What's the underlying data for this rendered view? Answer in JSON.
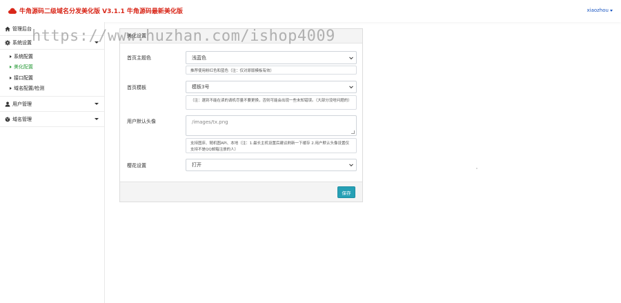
{
  "header": {
    "title": "牛角源码二级域名分发美化版 V3.1.1 牛角源码最新美化版",
    "brand_color": "#d9281a",
    "user": "xiaozhou"
  },
  "sidebar": {
    "top_item": "管理后台",
    "groups": [
      {
        "label": "系统设置",
        "items": [
          "系统配置",
          "美化配置",
          "接口配置",
          "域名配置/检测"
        ],
        "active_index": 1
      },
      {
        "label": "用户管理"
      },
      {
        "label": "域名管理"
      }
    ],
    "active_color": "#2e9d3e"
  },
  "main": {
    "card_title": "美化设置",
    "fields": [
      {
        "label": "首页主题色",
        "value": "浅蓝色",
        "help": "推荐使用粉红色和蓝色（注：仅对原版模板有效）"
      },
      {
        "label": "首页模板",
        "value": "模板3号",
        "help": "（注：選到不能在读的请机尽量不要更换，否则可能会出现一些未知错误。（大部分没啥问题的）"
      },
      {
        "label": "用户默认头像",
        "value": "/images/tx.png",
        "help": "支持图床、随机图API、本地（注：1.最长主机设置后建议刷新一下缓存 2.用户默认头像设置仅支持不是QQ邮箱注册的人）"
      },
      {
        "label": "樱花设置",
        "value": "打开"
      }
    ],
    "save_label": "保存",
    "save_color": "#26a0b5"
  },
  "watermark": "https://www.huzhan.com/ishop4009"
}
